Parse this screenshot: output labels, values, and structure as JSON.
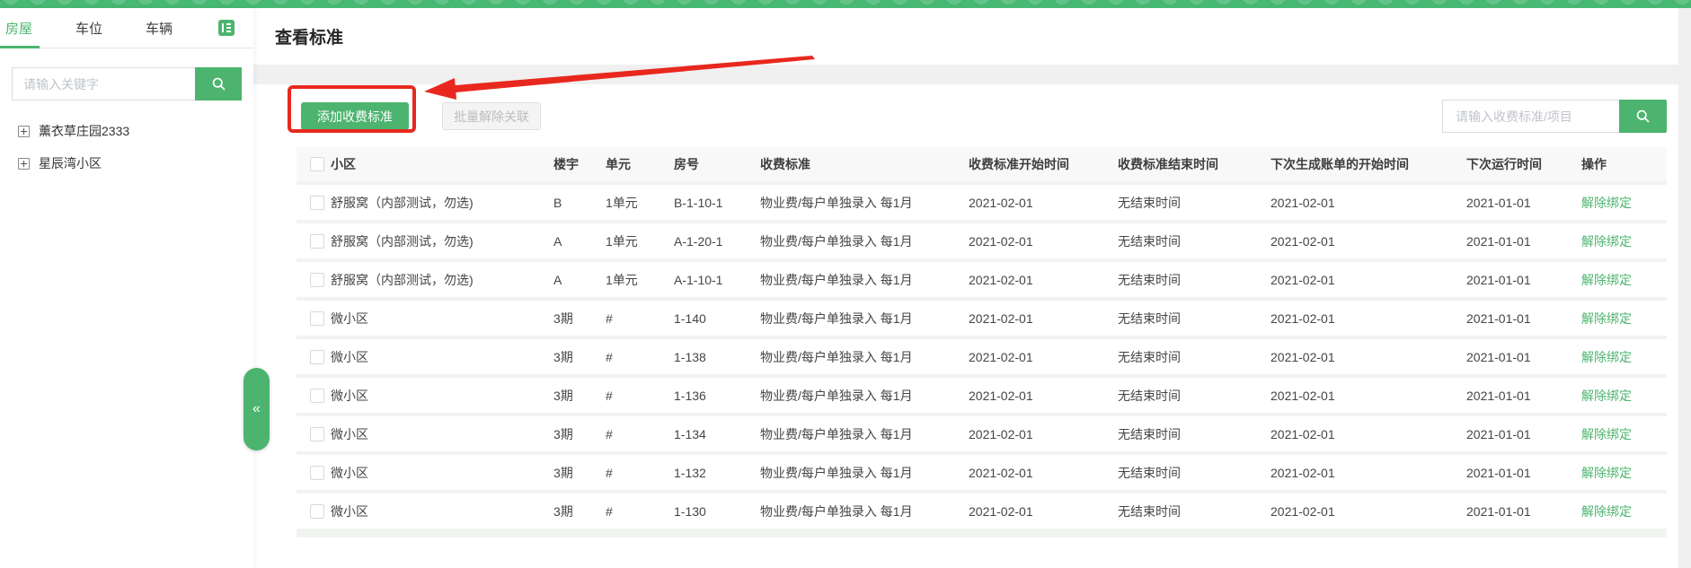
{
  "sidebar": {
    "tabs": [
      {
        "label": "房屋",
        "active": true
      },
      {
        "label": "车位",
        "active": false
      },
      {
        "label": "车辆",
        "active": false
      }
    ],
    "search": {
      "placeholder": "请输入关键字"
    },
    "tree_items": [
      {
        "label": "薰衣草庄园2333"
      },
      {
        "label": "星辰湾小区"
      }
    ],
    "collapse_glyph": "«"
  },
  "page": {
    "title": "查看标准"
  },
  "toolbar": {
    "add_button": "添加收费标准",
    "batch_unlink_button": "批量解除关联",
    "search_placeholder": "请输入收费标准/项目"
  },
  "table": {
    "columns": [
      "小区",
      "楼宇",
      "单元",
      "房号",
      "收费标准",
      "收费标准开始时间",
      "收费标准结束时间",
      "下次生成账单的开始时间",
      "下次运行时间",
      "操作"
    ],
    "action_label": "解除绑定",
    "rows": [
      {
        "community": "舒服窝（内部测试，勿选)",
        "building": "B",
        "unit": "1单元",
        "room": "B-1-10-1",
        "standard": "物业费/每户单独录入 每1月",
        "start": "2021-02-01",
        "end": "无结束时间",
        "next_bill_start": "2021-02-01",
        "next_run": "2021-01-01"
      },
      {
        "community": "舒服窝（内部测试，勿选)",
        "building": "A",
        "unit": "1单元",
        "room": "A-1-20-1",
        "standard": "物业费/每户单独录入 每1月",
        "start": "2021-02-01",
        "end": "无结束时间",
        "next_bill_start": "2021-02-01",
        "next_run": "2021-01-01"
      },
      {
        "community": "舒服窝（内部测试，勿选)",
        "building": "A",
        "unit": "1单元",
        "room": "A-1-10-1",
        "standard": "物业费/每户单独录入 每1月",
        "start": "2021-02-01",
        "end": "无结束时间",
        "next_bill_start": "2021-02-01",
        "next_run": "2021-01-01"
      },
      {
        "community": "微小区",
        "building": "3期",
        "unit": "#",
        "room": "1-140",
        "standard": "物业费/每户单独录入 每1月",
        "start": "2021-02-01",
        "end": "无结束时间",
        "next_bill_start": "2021-02-01",
        "next_run": "2021-01-01"
      },
      {
        "community": "微小区",
        "building": "3期",
        "unit": "#",
        "room": "1-138",
        "standard": "物业费/每户单独录入 每1月",
        "start": "2021-02-01",
        "end": "无结束时间",
        "next_bill_start": "2021-02-01",
        "next_run": "2021-01-01"
      },
      {
        "community": "微小区",
        "building": "3期",
        "unit": "#",
        "room": "1-136",
        "standard": "物业费/每户单独录入 每1月",
        "start": "2021-02-01",
        "end": "无结束时间",
        "next_bill_start": "2021-02-01",
        "next_run": "2021-01-01"
      },
      {
        "community": "微小区",
        "building": "3期",
        "unit": "#",
        "room": "1-134",
        "standard": "物业费/每户单独录入 每1月",
        "start": "2021-02-01",
        "end": "无结束时间",
        "next_bill_start": "2021-02-01",
        "next_run": "2021-01-01"
      },
      {
        "community": "微小区",
        "building": "3期",
        "unit": "#",
        "room": "1-132",
        "standard": "物业费/每户单独录入 每1月",
        "start": "2021-02-01",
        "end": "无结束时间",
        "next_bill_start": "2021-02-01",
        "next_run": "2021-01-01"
      },
      {
        "community": "微小区",
        "building": "3期",
        "unit": "#",
        "room": "1-130",
        "standard": "物业费/每户单独录入 每1月",
        "start": "2021-02-01",
        "end": "无结束时间",
        "next_bill_start": "2021-02-01",
        "next_run": "2021-01-01"
      }
    ]
  },
  "colors": {
    "primary_green": "#4cb46e",
    "annotation_red": "#e8281e"
  }
}
